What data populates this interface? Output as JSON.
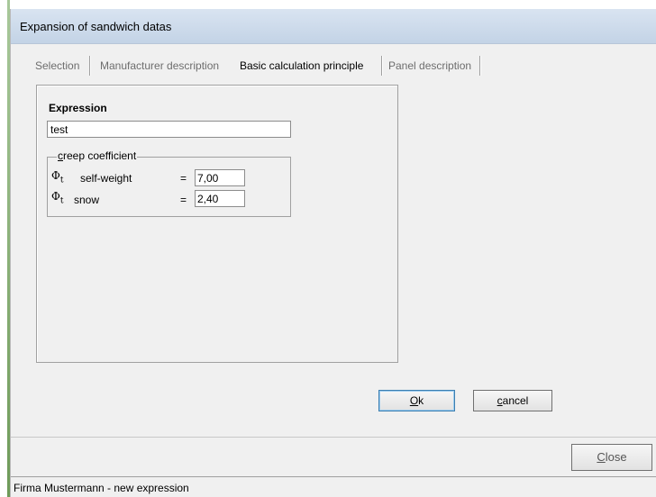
{
  "window": {
    "title": "Expansion of sandwich datas"
  },
  "tabs": [
    {
      "label": "Selection"
    },
    {
      "label": "Manufacturer description"
    },
    {
      "label": "Basic calculation principle",
      "active": true
    },
    {
      "label": "Panel description"
    }
  ],
  "form": {
    "expression_label": "Expression",
    "expression_value": "test",
    "group_label_accel": "c",
    "group_label_rest": "reep coefficient",
    "phi_symbol": "Φ",
    "phi_sub": "t",
    "rows": [
      {
        "label": "self-weight",
        "eq": "=",
        "value": "7,00"
      },
      {
        "label": "snow",
        "eq": "=",
        "value": "2,40"
      }
    ]
  },
  "buttons": {
    "ok_accel": "O",
    "ok_rest": "k",
    "cancel_accel": "c",
    "cancel_rest": "ancel",
    "close_accel": "C",
    "close_rest": "lose"
  },
  "status": {
    "text": "Firma Mustermann - new expression"
  },
  "colors": {
    "titlebar": "#c9d8ea",
    "window_bg": "#f0f0f0",
    "default_button_border": "#3c7fb1"
  }
}
